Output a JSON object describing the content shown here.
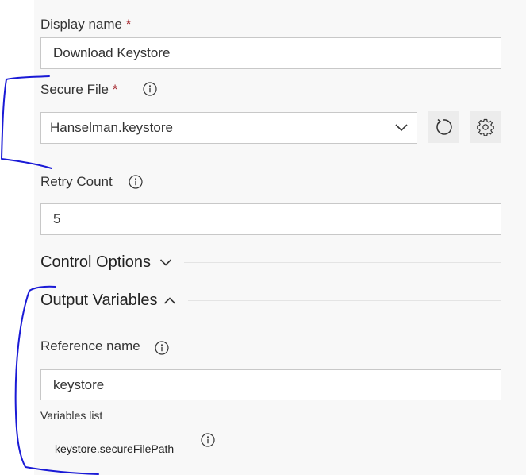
{
  "fields": {
    "display_name": {
      "label": "Display name",
      "required_mark": "*",
      "value": "Download Keystore"
    },
    "secure_file": {
      "label": "Secure File",
      "required_mark": "*",
      "selected": "Hanselman.keystore"
    },
    "retry_count": {
      "label": "Retry Count",
      "value": "5"
    }
  },
  "control_options": {
    "title": "Control Options",
    "state": "collapsed"
  },
  "output_variables": {
    "title": "Output Variables",
    "state": "expanded",
    "reference_name": {
      "label": "Reference name",
      "value": "keystore"
    },
    "variables_list": {
      "label": "Variables list",
      "items": [
        "keystore.secureFilePath"
      ]
    }
  },
  "annotation_color": "#1a1ad6"
}
